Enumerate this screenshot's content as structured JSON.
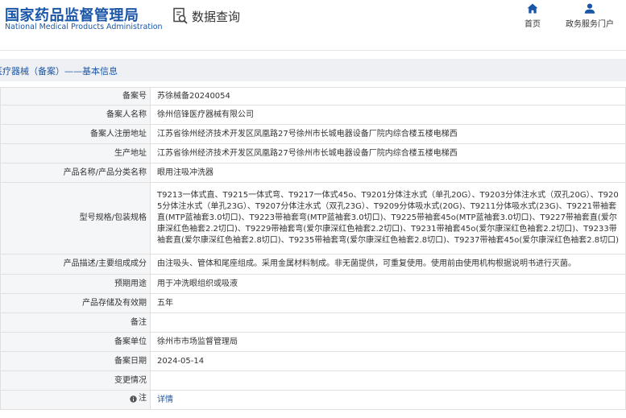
{
  "header": {
    "logo_cn": "国家药品监督管理局",
    "logo_en": "National Medical Products Administration",
    "query_label": "数据查询",
    "nav": [
      {
        "label": "首页",
        "icon": "home-icon"
      },
      {
        "label": "政务服务门户",
        "icon": "user-icon"
      }
    ]
  },
  "section_title": "医疗器械（备案）——基本信息",
  "rows": [
    {
      "label": "备案号",
      "value": "苏徐械备20240054"
    },
    {
      "label": "备案人名称",
      "value": "徐州倍锋医疗器械有限公司"
    },
    {
      "label": "备案人注册地址",
      "value": "江苏省徐州经济技术开发区凤凰路27号徐州市长城电器设备厂院内综合楼五楼电梯西"
    },
    {
      "label": "生产地址",
      "value": "江苏省徐州经济技术开发区凤凰路27号徐州市长城电器设备厂院内综合楼五楼电梯西"
    },
    {
      "label": "产品名称/产品分类名称",
      "value": "眼用注吸冲洗器"
    },
    {
      "label": "型号规格/包装规格",
      "value": "T9213一体式直、T9215一体式弯、T9217一体式45o、T9201分体注水式（单孔20G）、T9203分体注水式（双孔20G）、T9205分体注水式（单孔23G）、T9207分体注水式（双孔23G）、T9209分体吸水式(20G)、T9211分体吸水式(23G)、T9221带袖套直(MTP蓝袖套3.0切口)、T9223带袖套弯(MTP蓝袖套3.0切口)、T9225带袖套45o(MTP蓝袖套3.0切口)、T9227带袖套直(爱尔康深红色袖套2.2切口)、T9229带袖套弯(爱尔康深红色袖套2.2切口)、T9231带袖套45o(爱尔康深红色袖套2.2切口)、T9233带袖套直(爱尔康深红色袖套2.8切口)、T9235带袖套弯(爱尔康深红色袖套2.8切口)、T9237带袖套45o(爱尔康深红色袖套2.8切口)"
    },
    {
      "label": "产品描述/主要组成成分",
      "value": "由注吸头、管体和尾座组成。采用金属材料制成。非无菌提供，可重复使用。使用前由使用机构根据说明书进行灭菌。"
    },
    {
      "label": "预期用途",
      "value": "用于冲洗眼组织或吸液"
    },
    {
      "label": "产品存储及有效期",
      "value": "五年"
    },
    {
      "label": "备注",
      "value": ""
    },
    {
      "label": "备案单位",
      "value": "徐州市市场监督管理局"
    },
    {
      "label": "备案日期",
      "value": "2024-05-14"
    },
    {
      "label": "变更情况",
      "value": ""
    },
    {
      "label": "注",
      "value": "详情",
      "icon": "info-icon"
    }
  ],
  "colors": {
    "brand": "#1a56a8",
    "label_bg": "#f5f6f8",
    "title_bg": "#eef0f3"
  }
}
